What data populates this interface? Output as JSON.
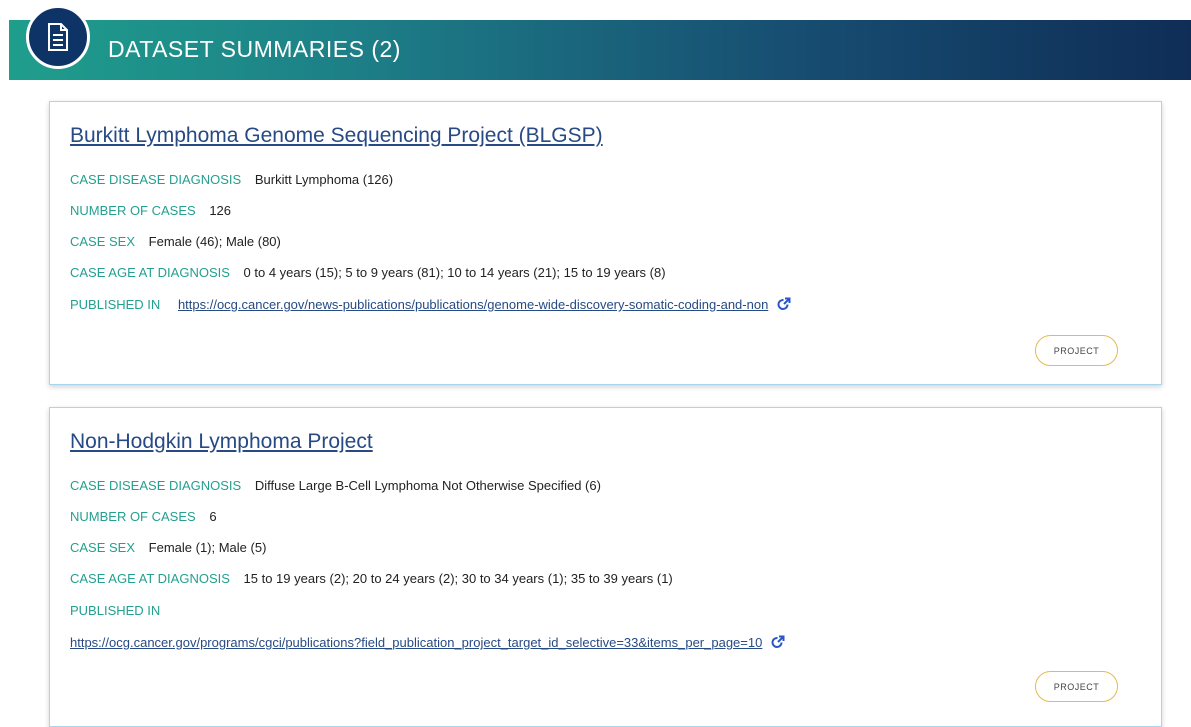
{
  "header": {
    "title": "DATASET SUMMARIES (2)",
    "icon": "document-icon"
  },
  "labels": {
    "disease": "CASE DISEASE DIAGNOSIS",
    "cases": "NUMBER OF CASES",
    "sex": "CASE SEX",
    "age": "CASE AGE AT DIAGNOSIS",
    "published": "PUBLISHED IN",
    "project_button": "PROJECT"
  },
  "datasets": [
    {
      "title": "Burkitt Lymphoma Genome Sequencing Project (BLGSP)",
      "disease": "Burkitt Lymphoma (126)",
      "cases": "126",
      "sex": "Female (46); Male (80)",
      "age": "0 to 4 years (15); 5 to 9 years (81); 10 to 14 years (21); 15 to 19 years (8)",
      "published": "https://ocg.cancer.gov/news-publications/publications/genome-wide-discovery-somatic-coding-and-non"
    },
    {
      "title": "Non-Hodgkin Lymphoma Project",
      "disease": "Diffuse Large B-Cell Lymphoma Not Otherwise Specified (6)",
      "cases": "6",
      "sex": "Female (1); Male (5)",
      "age": "15 to 19 years (2); 20 to 24 years (2); 30 to 34 years (1); 35 to 39 years (1)",
      "published": "https://ocg.cancer.gov/programs/cgci/publications?field_publication_project_target_id_selective=33&items_per_page=10"
    }
  ],
  "colors": {
    "label": "#23a08f",
    "link": "#274a84",
    "button_border": "#e9b94a"
  }
}
